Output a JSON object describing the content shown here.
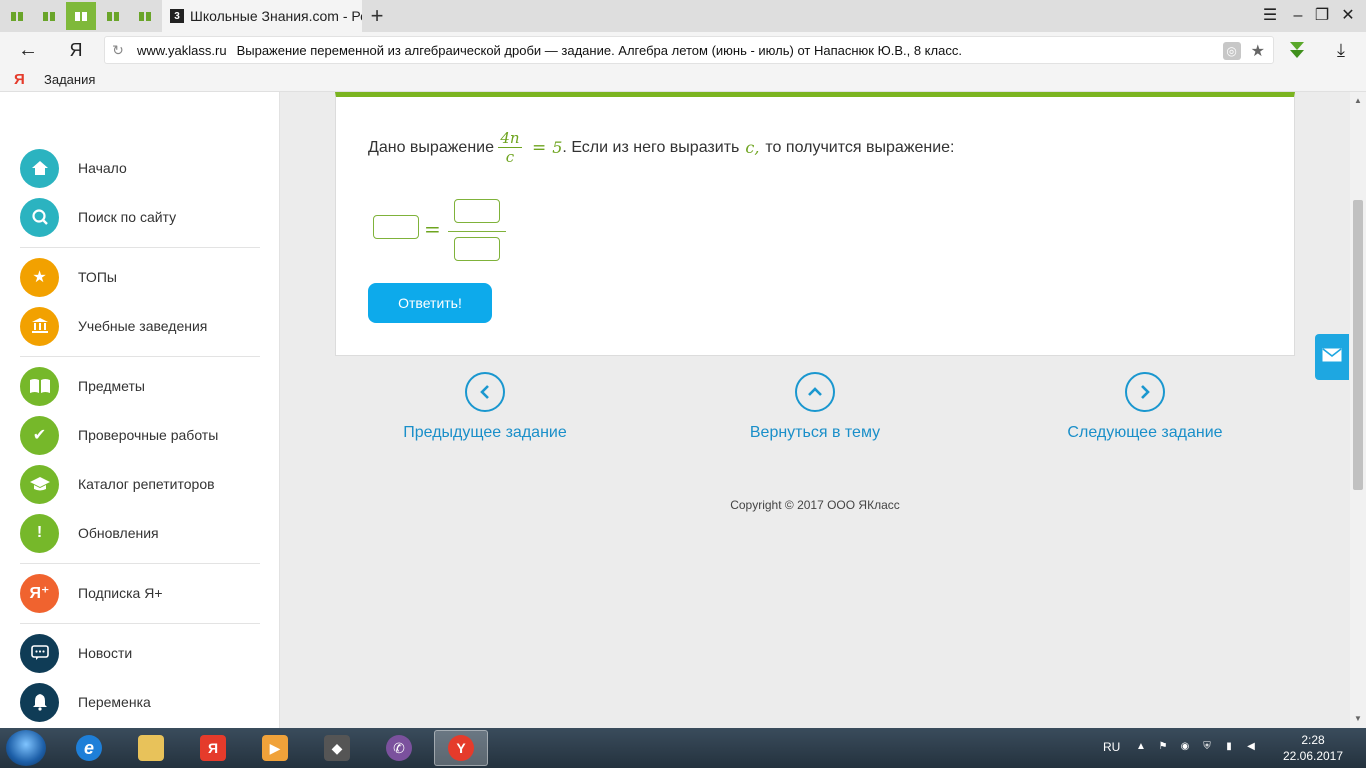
{
  "browser": {
    "active_tab_title": "Школьные Знания.com - Ре",
    "active_tab_favicon": "3",
    "new_tab_symbol": "+",
    "address": {
      "domain": "www.yaklass.ru",
      "page_title": "Выражение переменной из алгебраической дроби — задание. Алгебра летом (июнь - июль) от Напаснюк Ю.В., 8 класс."
    },
    "bookmark_ya": "Я",
    "bookmark_label": "Задания"
  },
  "sidebar": {
    "items": [
      {
        "label": "Начало",
        "icon": "home-icon"
      },
      {
        "label": "Поиск по сайту",
        "icon": "search-icon"
      },
      {
        "label": "ТОПы",
        "icon": "star-icon"
      },
      {
        "label": "Учебные заведения",
        "icon": "institution-icon"
      },
      {
        "label": "Предметы",
        "icon": "book-icon"
      },
      {
        "label": "Проверочные работы",
        "icon": "check-icon"
      },
      {
        "label": "Каталог репетиторов",
        "icon": "graduation-cap-icon"
      },
      {
        "label": "Обновления",
        "icon": "exclamation-icon"
      },
      {
        "label": "Подписка Я+",
        "icon": "yaplus-icon"
      },
      {
        "label": "Новости",
        "icon": "chat-icon"
      },
      {
        "label": "Переменка",
        "icon": "bell-icon"
      }
    ]
  },
  "task": {
    "text_before": "Дано выражение",
    "numerator": "4n",
    "denominator": "c",
    "equals": "=",
    "rhs": "5",
    "text_middle": ". Если из него выразить",
    "variable": "c,",
    "text_after": "то получится выражение:",
    "answer_equals": "=",
    "answer_button": "Ответить!"
  },
  "navigation": {
    "prev": "Предыдущее задание",
    "up": "Вернуться в тему",
    "next": "Следующее задание"
  },
  "footer": {
    "copyright": "Copyright © 2017 ООО ЯКласс"
  },
  "taskbar": {
    "tray_lang": "RU",
    "time": "2:28",
    "date": "22.06.2017",
    "yandex_letter": "Я"
  },
  "colors": {
    "accent_green": "#7bb420",
    "link_blue": "#1a8fc9",
    "button_blue": "#0daaeb"
  }
}
